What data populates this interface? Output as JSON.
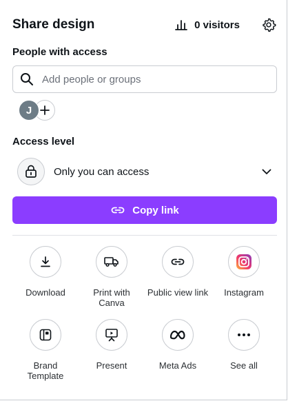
{
  "header": {
    "title": "Share design",
    "visitors": "0 visitors",
    "settings_icon": "gear-icon"
  },
  "people": {
    "label": "People with access",
    "search_placeholder": "Add people or groups",
    "avatar_initial": "J"
  },
  "access": {
    "label": "Access level",
    "value": "Only you can access"
  },
  "copy_link": {
    "label": "Copy link",
    "color": "#8b3dff"
  },
  "actions": [
    {
      "label": "Download",
      "icon": "download-icon"
    },
    {
      "label": "Print with\nCanva",
      "icon": "truck-icon"
    },
    {
      "label": "Public view link",
      "icon": "link-icon"
    },
    {
      "label": "Instagram",
      "icon": "instagram-icon"
    },
    {
      "label": "Brand\nTemplate",
      "icon": "brand-template-icon"
    },
    {
      "label": "Present",
      "icon": "present-icon"
    },
    {
      "label": "Meta Ads",
      "icon": "meta-icon"
    },
    {
      "label": "See all",
      "icon": "more-icon"
    }
  ]
}
